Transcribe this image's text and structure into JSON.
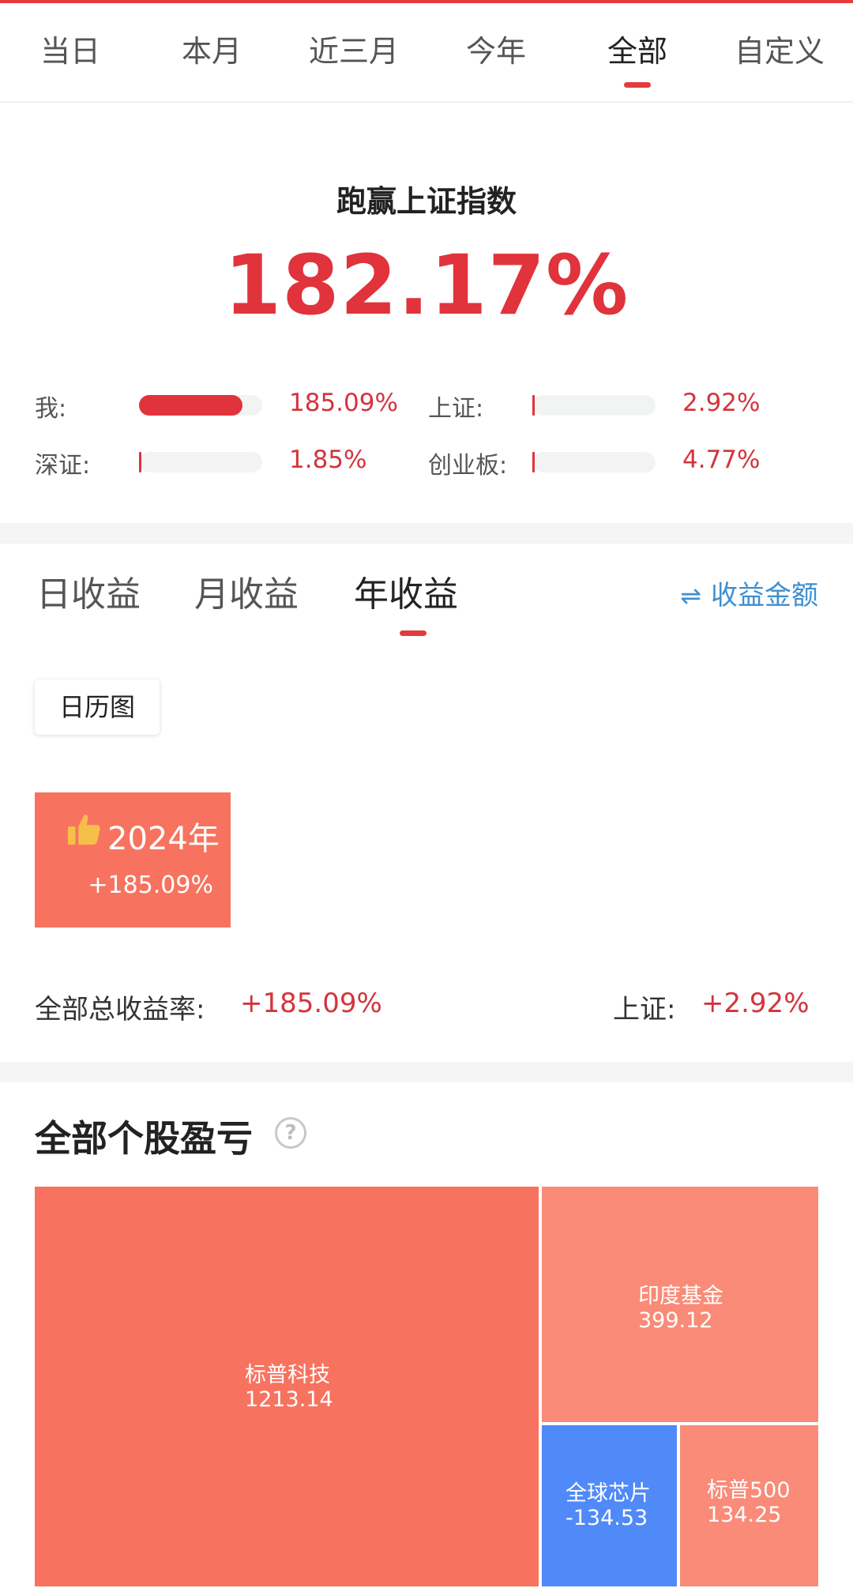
{
  "period_tabs": [
    {
      "label": "当日"
    },
    {
      "label": "本月"
    },
    {
      "label": "近三月"
    },
    {
      "label": "今年"
    },
    {
      "label": "全部"
    },
    {
      "label": "自定义"
    }
  ],
  "period_selected": "全部",
  "beat": {
    "title": "跑赢上证指数",
    "value": "182.17%"
  },
  "comparisons": [
    {
      "label": "我:",
      "value": "185.09%",
      "fill_fraction": 0.84
    },
    {
      "label": "上证:",
      "value": "2.92%",
      "fill_fraction": 0.013
    },
    {
      "label": "深证:",
      "value": "1.85%",
      "fill_fraction": 0.009
    },
    {
      "label": "创业板:",
      "value": "4.77%",
      "fill_fraction": 0.02
    }
  ],
  "return_tabs": [
    {
      "label": "日收益"
    },
    {
      "label": "月收益"
    },
    {
      "label": "年收益"
    }
  ],
  "return_selected": "年收益",
  "amount_toggle": {
    "icon": "swap-arrows-icon",
    "label": "收益金额"
  },
  "calendar_button": "日历图",
  "year_card": {
    "icon": "thumbs-up-icon",
    "year": "2024年",
    "return": "+185.09%"
  },
  "summary": {
    "total_label": "全部总收益率:",
    "total_value": "+185.09%",
    "index_label": "上证:",
    "index_value": "+2.92%"
  },
  "stocks": {
    "title": "全部个股盈亏",
    "help_icon": "question-mark-icon",
    "items": [
      {
        "name": "标普科技",
        "value": "1213.14",
        "color": "#f7735f"
      },
      {
        "name": "印度基金",
        "value": "399.12",
        "color": "#f98b78"
      },
      {
        "name": "全球芯片",
        "value": "-134.53",
        "color": "#5089f8"
      },
      {
        "name": "标普500",
        "value": "134.25",
        "color": "#f98b78"
      }
    ]
  },
  "colors": {
    "accent_red": "#e0333c",
    "link_blue": "#3f8fd0",
    "loss_blue": "#5089f8",
    "gain_coral": "#f7735f"
  }
}
